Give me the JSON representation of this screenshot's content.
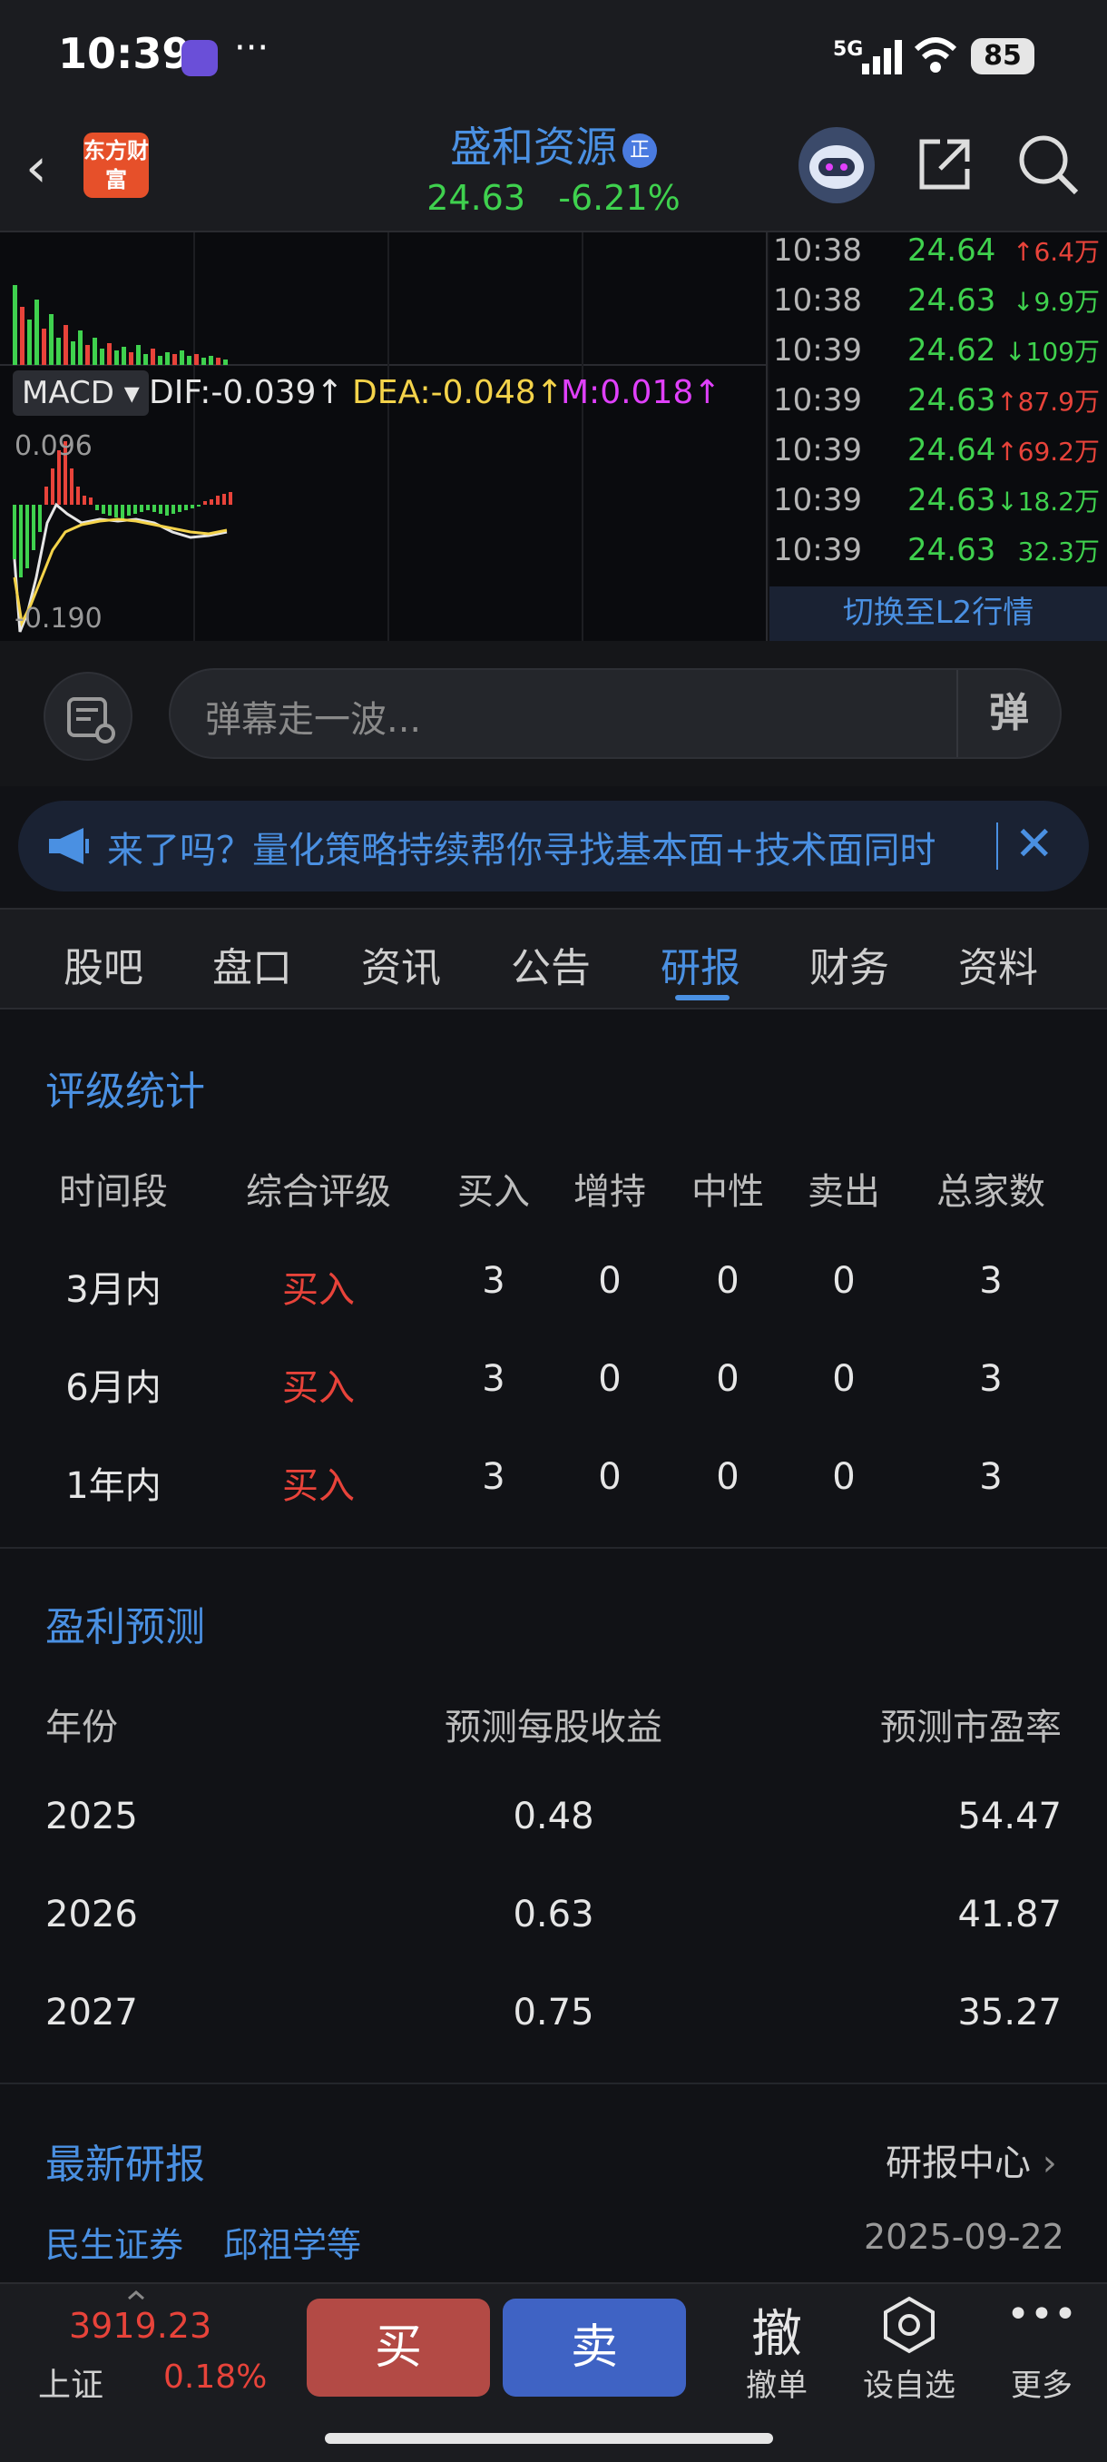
{
  "status": {
    "time": "10:39",
    "dots": "···",
    "net": "5G",
    "battery": "85"
  },
  "header": {
    "logo": "东方财富",
    "name": "盛和资源",
    "badge": "正",
    "price": "24.63",
    "change": "-6.21%"
  },
  "chart": {
    "macd_tag": "MACD ▾",
    "dif": "DIF:-0.039↑",
    "dea": "DEA:-0.048↑",
    "m": "M:0.018↑",
    "axis_top": "0.096",
    "axis_bottom": "-0.190"
  },
  "ticks": [
    {
      "time": "10:38",
      "price": "24.64",
      "vol": "↑6.4万",
      "dir": "up"
    },
    {
      "time": "10:38",
      "price": "24.63",
      "vol": "↓9.9万",
      "dir": "down"
    },
    {
      "time": "10:39",
      "price": "24.62",
      "vol": "↓109万",
      "dir": "down"
    },
    {
      "time": "10:39",
      "price": "24.63",
      "vol": "↑87.9万",
      "dir": "up"
    },
    {
      "time": "10:39",
      "price": "24.64",
      "vol": "↑69.2万",
      "dir": "up"
    },
    {
      "time": "10:39",
      "price": "24.63",
      "vol": "↓18.2万",
      "dir": "down"
    },
    {
      "time": "10:39",
      "price": "24.63",
      "vol": "32.3万",
      "dir": "down"
    }
  ],
  "l2": "切换至L2行情",
  "danmu": {
    "placeholder": "弹幕走一波...",
    "btn": "弹"
  },
  "notice": "来了吗？量化策略持续帮你寻找基本面+技术面同时",
  "tabs": [
    "股吧",
    "盘口",
    "资讯",
    "公告",
    "研报",
    "财务",
    "资料"
  ],
  "rating": {
    "title": "评级统计",
    "headers": [
      "时间段",
      "综合评级",
      "买入",
      "增持",
      "中性",
      "卖出",
      "总家数"
    ],
    "rows": [
      [
        "3月内",
        "买入",
        "3",
        "0",
        "0",
        "0",
        "3"
      ],
      [
        "6月内",
        "买入",
        "3",
        "0",
        "0",
        "0",
        "3"
      ],
      [
        "1年内",
        "买入",
        "3",
        "0",
        "0",
        "0",
        "3"
      ]
    ]
  },
  "forecast": {
    "title": "盈利预测",
    "headers": [
      "年份",
      "预测每股收益",
      "预测市盈率"
    ],
    "rows": [
      [
        "2025",
        "0.48",
        "54.47"
      ],
      [
        "2026",
        "0.63",
        "41.87"
      ],
      [
        "2027",
        "0.75",
        "35.27"
      ]
    ]
  },
  "research": {
    "title": "最新研报",
    "center": "研报中心",
    "org": "民生证券",
    "author": "邱祖学等",
    "date": "2025-09-22"
  },
  "bottom": {
    "index_val": "3919.23",
    "index_name": "上证",
    "index_pct": "0.18%",
    "buy": "买",
    "sell": "卖",
    "cancel_glyph": "撤",
    "cancel": "撤单",
    "watch": "设自选",
    "more": "更多"
  },
  "colors": {
    "up": "#e8433a",
    "down": "#3fd14e",
    "accent": "#4a90e2"
  }
}
